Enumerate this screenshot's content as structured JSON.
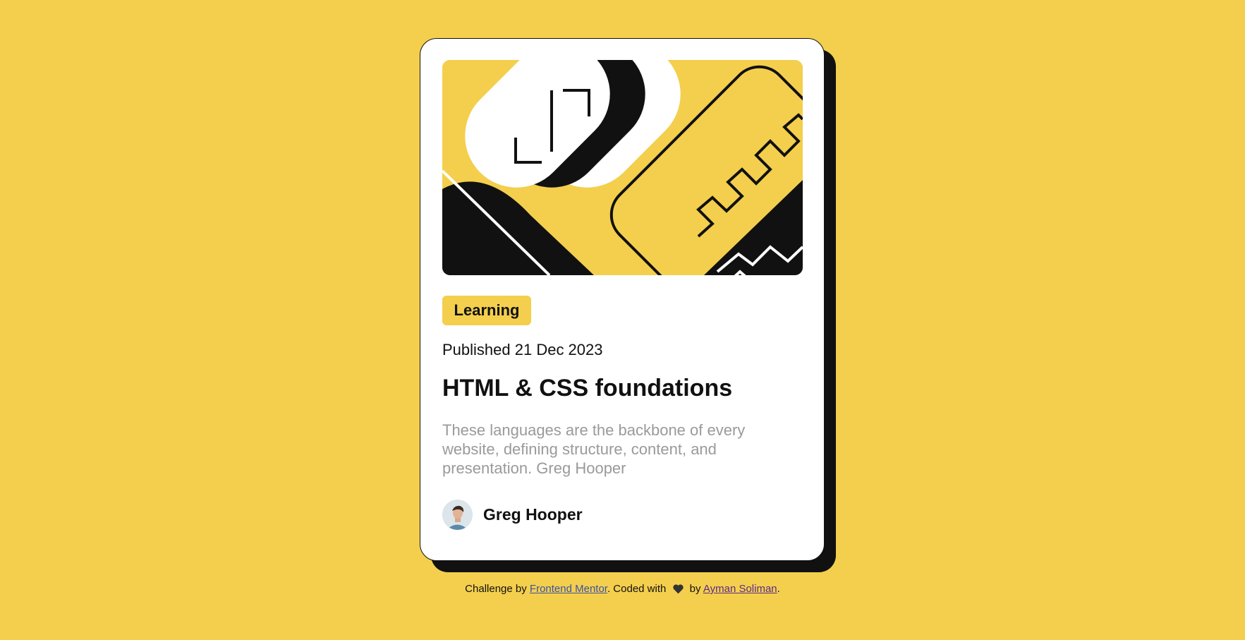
{
  "card": {
    "tag": "Learning",
    "published": "Published 21 Dec 2023",
    "title": "HTML & CSS foundations",
    "description": "These languages are the backbone of every website, defining structure, content, and presentation. Greg Hooper",
    "author": "Greg Hooper",
    "hero_illustration": "abstract-geometric-illustration"
  },
  "attribution": {
    "prefix": "Challenge by ",
    "link1": "Frontend Mentor",
    "middle": ". Coded with ",
    "heart": "heart-icon",
    "by": " by ",
    "link2": "Ayman Soliman",
    "suffix": "."
  },
  "colors": {
    "background": "#F4CF4D",
    "card": "#FFFFFF",
    "ink": "#111111",
    "muted": "#9A9A9A"
  }
}
